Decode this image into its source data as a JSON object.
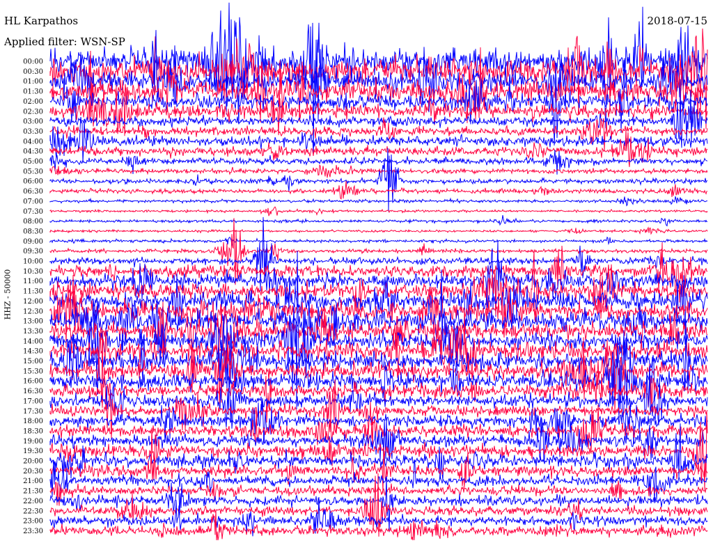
{
  "header": {
    "station": "HL Karpathos",
    "filter": "Applied filter: WSN-SP",
    "date": "2018-07-15"
  },
  "chart_data": {
    "type": "helicorder",
    "title": "HL Karpathos",
    "date": "2018-07-15",
    "filter": "Applied filter: WSN-SP",
    "ylabel": "HHZ - 50000",
    "time_labels": [
      "00:00",
      "00:30",
      "01:00",
      "01:30",
      "02:00",
      "02:30",
      "03:00",
      "03:30",
      "04:00",
      "04:30",
      "05:00",
      "05:30",
      "06:00",
      "06:30",
      "07:00",
      "07:30",
      "08:00",
      "08:30",
      "09:00",
      "09:30",
      "10:00",
      "10:30",
      "11:00",
      "11:30",
      "12:00",
      "12:30",
      "13:00",
      "13:30",
      "14:00",
      "14:30",
      "15:00",
      "15:30",
      "16:00",
      "16:30",
      "17:00",
      "17:30",
      "18:00",
      "18:30",
      "19:00",
      "19:30",
      "20:00",
      "20:30",
      "21:00",
      "21:30",
      "22:00",
      "22:30",
      "23:00",
      "23:30"
    ],
    "trace_colors": [
      "#0000ff",
      "#ff0040"
    ],
    "relative_amplitude": [
      0.85,
      0.85,
      0.7,
      0.65,
      0.5,
      0.45,
      0.3,
      0.28,
      0.32,
      0.28,
      0.22,
      0.15,
      0.16,
      0.14,
      0.1,
      0.08,
      0.09,
      0.08,
      0.1,
      0.12,
      0.22,
      0.4,
      0.45,
      0.5,
      0.55,
      0.6,
      0.6,
      0.55,
      0.55,
      0.55,
      0.55,
      0.5,
      0.55,
      0.45,
      0.42,
      0.35,
      0.4,
      0.38,
      0.38,
      0.42,
      0.42,
      0.38,
      0.32,
      0.3,
      0.32,
      0.28,
      0.3,
      0.32
    ],
    "events": [
      {
        "time": "06:00",
        "strength": 1.0
      },
      {
        "time": "09:30",
        "strength": 0.6
      },
      {
        "time": "10:00",
        "strength": 0.5
      },
      {
        "time": "11:00",
        "strength": 0.9
      },
      {
        "time": "17:30",
        "strength": 0.7
      }
    ]
  }
}
